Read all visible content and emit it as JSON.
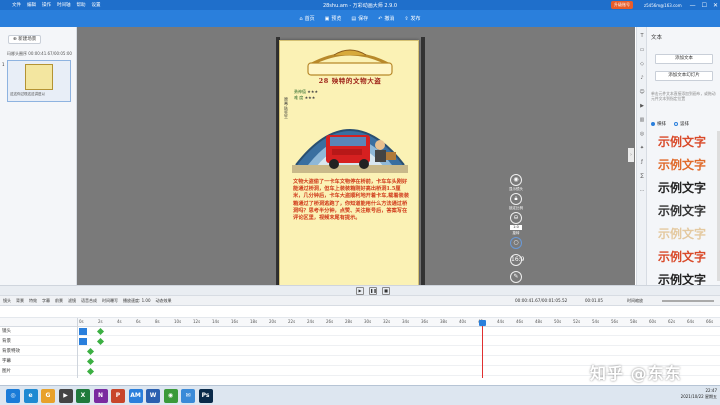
{
  "titlebar": {
    "menu": [
      "文件",
      "编辑",
      "操作",
      "时间轴",
      "帮助",
      "设置"
    ],
    "title": "28shu.am - 万彩动画大师 2.9.0",
    "upgrade": "升级账号",
    "user": "z5456m@163.com",
    "window_controls": [
      "—",
      "☐",
      "✕"
    ]
  },
  "toolbar": {
    "items": [
      "首页",
      "预览",
      "保存",
      "撤消",
      "发布"
    ]
  },
  "left": {
    "add_scene": "新建场景",
    "scene_label": "玛娜头圈序 00:00:41.67/00:05:00",
    "scene_index": "1",
    "thumb_caption": "这这你过现这这讲进以"
  },
  "page": {
    "number": "28",
    "title": "28 殃特的文物大盗",
    "stat1_label": "勇神值",
    "stat1_stars": "★★★",
    "stat2_label": "难 度",
    "stat2_stars": "★★★",
    "side_text": "原画·陆先生",
    "body": "文物大盗偷了一卡车文物停在桥前，卡车车头刚好能通过桥洞，但车上装装箱刚好高出桥洞1.5厘米，几分钟后，卡车大盗顺利地开着卡车,载着装装箱通过了桥洞逃跑了，你知道能用什么方法通过桥洞吗？思考半分钟，点赞、关注账号后，答案写在评论区里，视频末尾有提示。"
  },
  "canvas_tools": {
    "t1": "显示镜头",
    "t2": "锁定比例",
    "box": "1:0",
    "t3": "旋转",
    "ratio": "16:9"
  },
  "right": {
    "title": "文本",
    "btn_add_text": "添加文本",
    "btn_add_slide": "添加文本幻灯片",
    "hint": "单击元件文本直接添加到画布，或拖动元件文本到指定位置",
    "radio_h": "横排",
    "radio_v": "竖排",
    "samples": [
      {
        "text": "示例文字",
        "color": "#d94a2a"
      },
      {
        "text": "示例文字",
        "color": "#e06a2a"
      },
      {
        "text": "示例文字",
        "color": "#222222"
      },
      {
        "text": "示例文字",
        "color": "#333333"
      },
      {
        "text": "示例文字",
        "color": "#e4c9a0"
      },
      {
        "text": "示例文字",
        "color": "#d94a2a"
      },
      {
        "text": "示例文字",
        "color": "#222222"
      }
    ]
  },
  "timeline_bar": {
    "tools": [
      "镜头",
      "背景",
      "特效",
      "字幕",
      "前景",
      "滤镜",
      "语音合成",
      "时间曝写",
      "播放速度: 1.00",
      "动态效果"
    ],
    "time": "00:00:41.67/00:01:05.52",
    "zoom": "00:01.05",
    "tlzoom": "时间缩放"
  },
  "ruler": [
    "0s",
    "2s",
    "4s",
    "6s",
    "8s",
    "10s",
    "12s",
    "14s",
    "16s",
    "18s",
    "20s",
    "22s",
    "24s",
    "26s",
    "28s",
    "30s",
    "32s",
    "34s",
    "36s",
    "38s",
    "40s",
    "42s",
    "44s",
    "46s",
    "48s",
    "50s",
    "52s",
    "54s",
    "56s",
    "58s",
    "60s",
    "62s",
    "64s",
    "66s"
  ],
  "tracks": [
    "镜头",
    "背景",
    "背景特效",
    "字幕",
    "图片"
  ],
  "taskbar": {
    "apps": [
      {
        "label": "◎",
        "color": "#1a7bd8"
      },
      {
        "label": "e",
        "color": "#1f8ad2"
      },
      {
        "label": "G",
        "color": "#e8a12a"
      },
      {
        "label": "▶",
        "color": "#444444"
      },
      {
        "label": "X",
        "color": "#1f7a3c"
      },
      {
        "label": "N",
        "color": "#7a2aa0"
      },
      {
        "label": "P",
        "color": "#c8452a"
      },
      {
        "label": "AM",
        "color": "#2a7fdc"
      },
      {
        "label": "W",
        "color": "#2a5fb0"
      },
      {
        "label": "◉",
        "color": "#3a9a3a"
      },
      {
        "label": "✉",
        "color": "#3a8ad8"
      },
      {
        "label": "Ps",
        "color": "#0a2a4a"
      }
    ],
    "time": "22:47",
    "date": "2021/10/22 星期五"
  },
  "watermark": "知乎 @东东"
}
